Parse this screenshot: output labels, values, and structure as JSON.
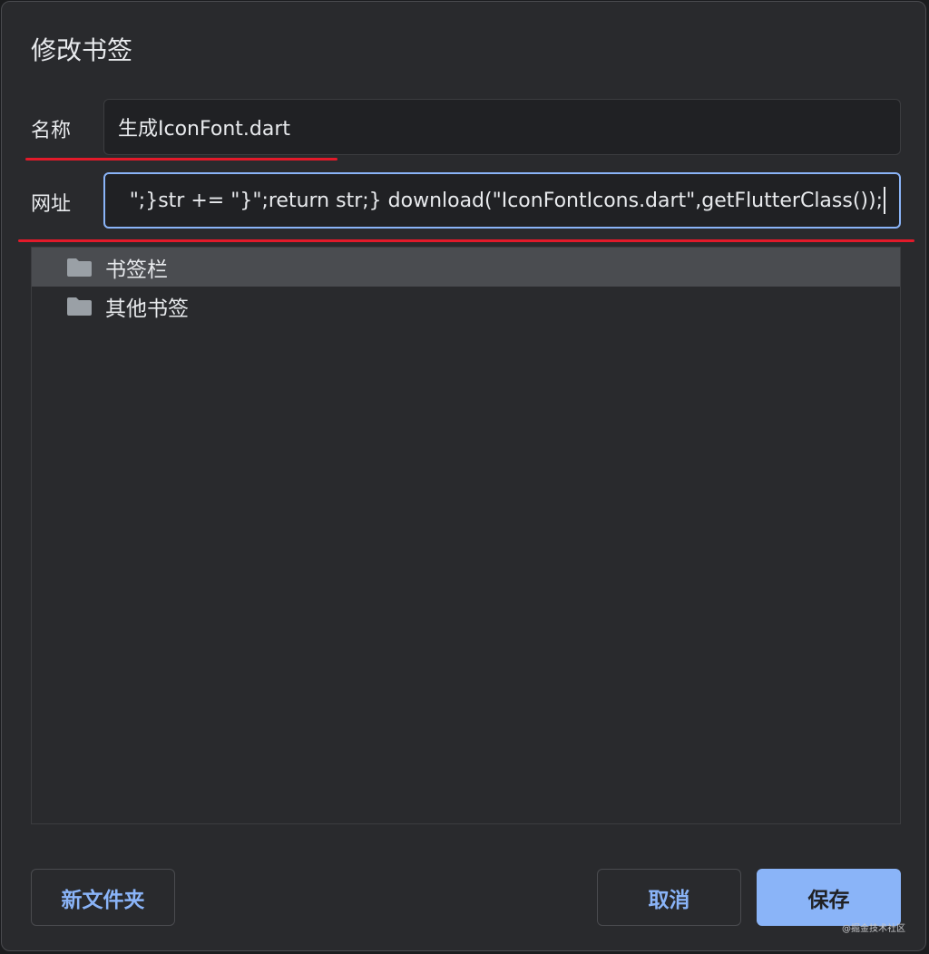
{
  "dialog": {
    "title": "修改书签",
    "name_label": "名称",
    "name_value": "生成IconFont.dart",
    "url_label": "网址",
    "url_value": "\";}str += \"}\";return str;}  download(\"IconFontIcons.dart\",getFlutterClass());"
  },
  "folders": [
    {
      "label": "书签栏",
      "selected": true,
      "icon": "folder-icon"
    },
    {
      "label": "其他书签",
      "selected": false,
      "icon": "folder-icon"
    }
  ],
  "buttons": {
    "new_folder": "新文件夹",
    "cancel": "取消",
    "save": "保存"
  },
  "watermark": "@掘金技术社区",
  "colors": {
    "accent": "#8ab4f8",
    "annotation_line": "#e21a2a",
    "background": "#292a2d"
  }
}
